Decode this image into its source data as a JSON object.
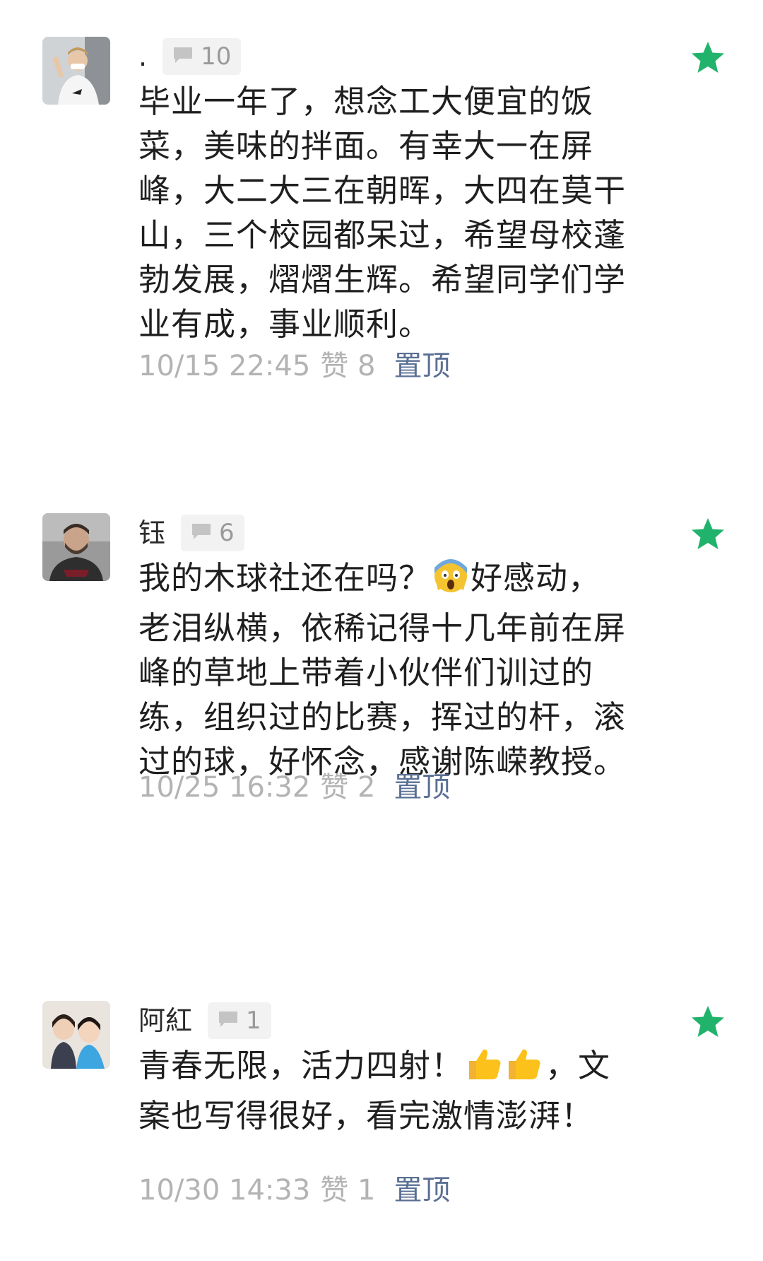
{
  "colors": {
    "star_green": "#21b36b",
    "meta_grey": "#b3b3b3",
    "pin_blue": "#5a6f93",
    "badge_bg": "#f2f2f2"
  },
  "comments": [
    {
      "name": ".",
      "reply_count": "10",
      "text": "毕业一年了，想念工大便宜的饭菜，美味的拌面。有幸大一在屏峰，大二大三在朝晖，大四在莫干山，三个校园都呆过，希望母校蓬勃发展，熠熠生辉。希望同学们学业有成，事业顺利。",
      "time": "10/15 22:45",
      "likes": "赞 8",
      "pin": "置顶",
      "avatar_icon": "avatar-man-white-shirt-icon",
      "starred": true
    },
    {
      "name": "钰",
      "reply_count": "6",
      "text_before": "我的木球社还在吗？",
      "emoji": "scream-emoji-icon",
      "text_after": "好感动，老泪纵横，依稀记得十几年前在屏峰的草地上带着小伙伴们训过的练，组织过的比赛，挥过的杆，滚过的球，好怀念，感谢陈嵘教授。",
      "time": "10/25 16:32",
      "likes": "赞 2",
      "pin": "置顶",
      "avatar_icon": "avatar-bearded-man-icon",
      "starred": true
    },
    {
      "name": "阿紅",
      "reply_count": "1",
      "text_before": "青春无限，活力四射！",
      "emoji": "thumbs-up-emoji-icon",
      "text_after": "，文案也写得很好，看完激情澎湃！",
      "time": "10/30 14:33",
      "likes": "赞 1",
      "pin": "置顶",
      "avatar_icon": "avatar-two-women-icon",
      "starred": true
    }
  ]
}
